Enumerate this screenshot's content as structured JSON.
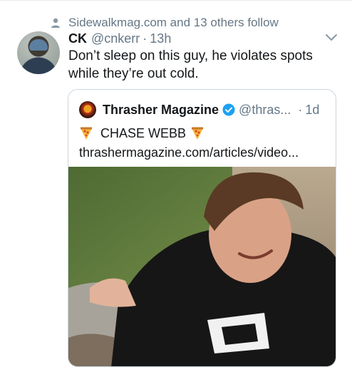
{
  "social_context": {
    "text": "Sidewalkmag.com and 13 others follow",
    "icon": "person-icon"
  },
  "tweet": {
    "author_name": "CK",
    "author_handle": "@cnkerr",
    "separator": "·",
    "timestamp": "13h",
    "text": "Don’t sleep on this guy, he violates spots while they’re out cold."
  },
  "quoted_tweet": {
    "author_name": "Thrasher Magazine",
    "verified": true,
    "author_handle": "@thras...",
    "separator": "·",
    "timestamp": "1d",
    "title": "CHASE WEBB",
    "title_icon": "pizza-icon",
    "link": "thrashermagazine.com/articles/video..."
  },
  "colors": {
    "text": "#14171a",
    "muted": "#657786",
    "border": "#ccd6dd",
    "verified": "#1da1f2"
  }
}
